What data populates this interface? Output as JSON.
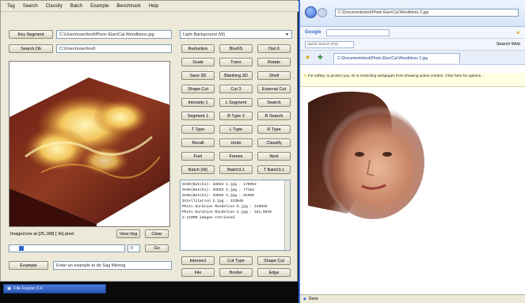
{
  "app": {
    "menu": [
      "Tag",
      "Search",
      "Classify",
      "Batch",
      "Example",
      "Benchmark",
      "Help"
    ],
    "top_buttons": {
      "key_segment": "Key Segment",
      "search_db": "Search Db"
    },
    "fields": {
      "key_segment_path": "C:\\Users\\user\\test\\Photo Elan\\Cal.Wenditions.jpg",
      "search_db_path": "C:\\Users\\user\\test\\"
    },
    "background_select": "Light Background (W)",
    "grid_buttons": [
      "Reduction",
      "Blur6S",
      "Dist 6",
      "Scale",
      "Trans",
      "Rotate",
      "Save 3D",
      "Blanking 3D",
      "Shell",
      "Shape Cut",
      "Cut 3",
      "External Cut",
      "Intensity 1",
      "L Segment",
      "Search",
      "Segment 1",
      "B Type 3",
      "R Search",
      "T Type",
      "L Type",
      "R Type",
      "Recall",
      "Undo",
      "Classify",
      "Fuel",
      "Freeze",
      "Next",
      "Batch (W)",
      "Batch3.1",
      "T Batch3.1"
    ],
    "textlog_lines": [
      "SAVE(Batch1): 3AED3 1.jpg : 176063",
      "SAVE(Batch1): 3AED3 2.jpg : 77164",
      "SAVE(Batch1): 3AED3 3.jpg : 61995",
      "Intellitarcon 2.jpg : 123049",
      "Photo Duration Mindelcon 5.jpg : 146049",
      "Photo Duration Mindelcon 2.jpg : 181.9539",
      "2.11000 images retrieved"
    ],
    "status_text": "ImageZone at [25,188] [ 3e] pixel",
    "view_img_button": "View Img",
    "clear_button": "Clear",
    "slider_value": "0",
    "go_button": "Go",
    "example_button": "Example",
    "example_field": "Enter an example to do Sag filtering",
    "bottom_buttons": [
      "Intersect",
      "Cut Type",
      "Shape Cut",
      "File",
      "Border",
      "Edge"
    ]
  },
  "taskbar": {
    "app_label": "File Fusion 3.4"
  },
  "browser": {
    "address": "C:\\Documents\\test\\Photo Elan\\Cal.Wenditions 2.jpg",
    "google_label": "Google",
    "quick_search": "Quick Search (F3)",
    "search_web": "Search Web",
    "tab_title": "C:\\Documents\\test\\Photo Elan\\Cal.Wenditions 2.jpg",
    "infobar_text": "For safety, to protect you, IE is restricting webpages from showing active content. Click here for options...",
    "status": "Done",
    "accent": "#3a6fd4"
  }
}
